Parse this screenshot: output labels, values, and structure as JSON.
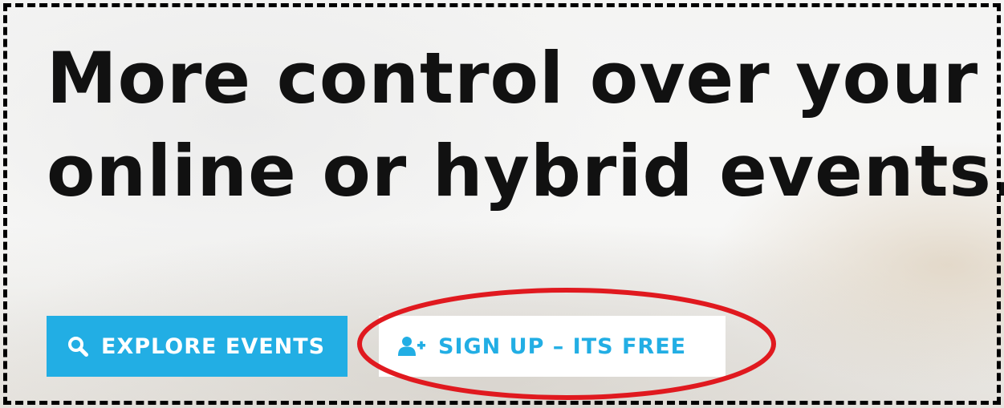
{
  "hero": {
    "headline_line1": "More control over your",
    "headline_line2": "online or hybrid events."
  },
  "buttons": {
    "explore": {
      "label": "EXPLORE EVENTS",
      "icon": "search-icon"
    },
    "signup": {
      "label": "SIGN UP – ITS FREE",
      "icon": "user-plus-icon"
    }
  },
  "colors": {
    "accent": "#22aee4",
    "headline": "#111111",
    "annotation": "#e0191f"
  }
}
